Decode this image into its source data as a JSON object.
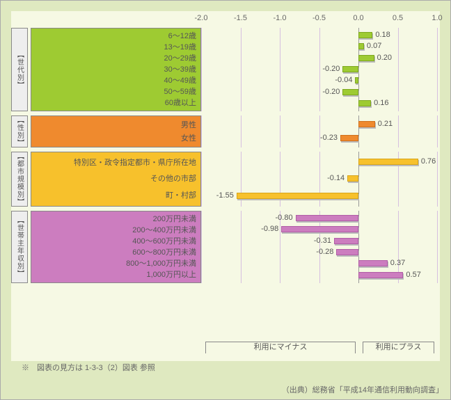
{
  "chart_data": {
    "type": "bar",
    "orientation": "horizontal",
    "xlim": [
      -2.0,
      1.0
    ],
    "xticks": [
      -2.0,
      -1.5,
      -1.0,
      -0.5,
      0.0,
      0.5,
      1.0
    ],
    "xtick_labels": [
      "-2.0",
      "-1.5",
      "-1.0",
      "-0.5",
      "0.0",
      "0.5",
      "1.0"
    ],
    "groups": [
      {
        "name": "【世代別】",
        "color": "green",
        "rows": [
          {
            "label": "6〜12歳",
            "value": 0.18,
            "vlabel": "0.18"
          },
          {
            "label": "13〜19歳",
            "value": 0.07,
            "vlabel": "0.07"
          },
          {
            "label": "20〜29歳",
            "value": 0.2,
            "vlabel": "0.20"
          },
          {
            "label": "30〜39歳",
            "value": -0.2,
            "vlabel": "-0.20"
          },
          {
            "label": "40〜49歳",
            "value": -0.04,
            "vlabel": "-0.04"
          },
          {
            "label": "50〜59歳",
            "value": -0.2,
            "vlabel": "-0.20"
          },
          {
            "label": "60歳以上",
            "value": 0.16,
            "vlabel": "0.16"
          }
        ]
      },
      {
        "name": "【性別】",
        "color": "orange",
        "rows": [
          {
            "label": "男性",
            "value": 0.21,
            "vlabel": "0.21"
          },
          {
            "label": "女性",
            "value": -0.23,
            "vlabel": "-0.23"
          }
        ]
      },
      {
        "name": "【都市規模別】",
        "color": "yellow",
        "rows": [
          {
            "label": "特別区・政令指定都市・県庁所在地",
            "value": 0.76,
            "vlabel": "0.76"
          },
          {
            "label": "その他の市部",
            "value": -0.14,
            "vlabel": "-0.14"
          },
          {
            "label": "町・村部",
            "value": -1.55,
            "vlabel": "-1.55"
          }
        ]
      },
      {
        "name": "【世帯主年収別】",
        "color": "pink",
        "rows": [
          {
            "label": "200万円未満",
            "value": -0.8,
            "vlabel": "-0.80"
          },
          {
            "label": "200〜400万円未満",
            "value": -0.98,
            "vlabel": "-0.98"
          },
          {
            "label": "400〜600万円未満",
            "value": -0.31,
            "vlabel": "-0.31"
          },
          {
            "label": "600〜800万円未満",
            "value": -0.28,
            "vlabel": "-0.28"
          },
          {
            "label": "800〜1,000万円未満",
            "value": 0.37,
            "vlabel": "0.37"
          },
          {
            "label": "1,000万円以上",
            "value": 0.57,
            "vlabel": "0.57"
          }
        ]
      }
    ],
    "bottom_labels": {
      "neg": "利用にマイナス",
      "pos": "利用にプラス"
    }
  },
  "footnote": "※　図表の見方は 1-3-3（2）図表 参照",
  "source": "（出典）総務省「平成14年通信利用動向調査」"
}
